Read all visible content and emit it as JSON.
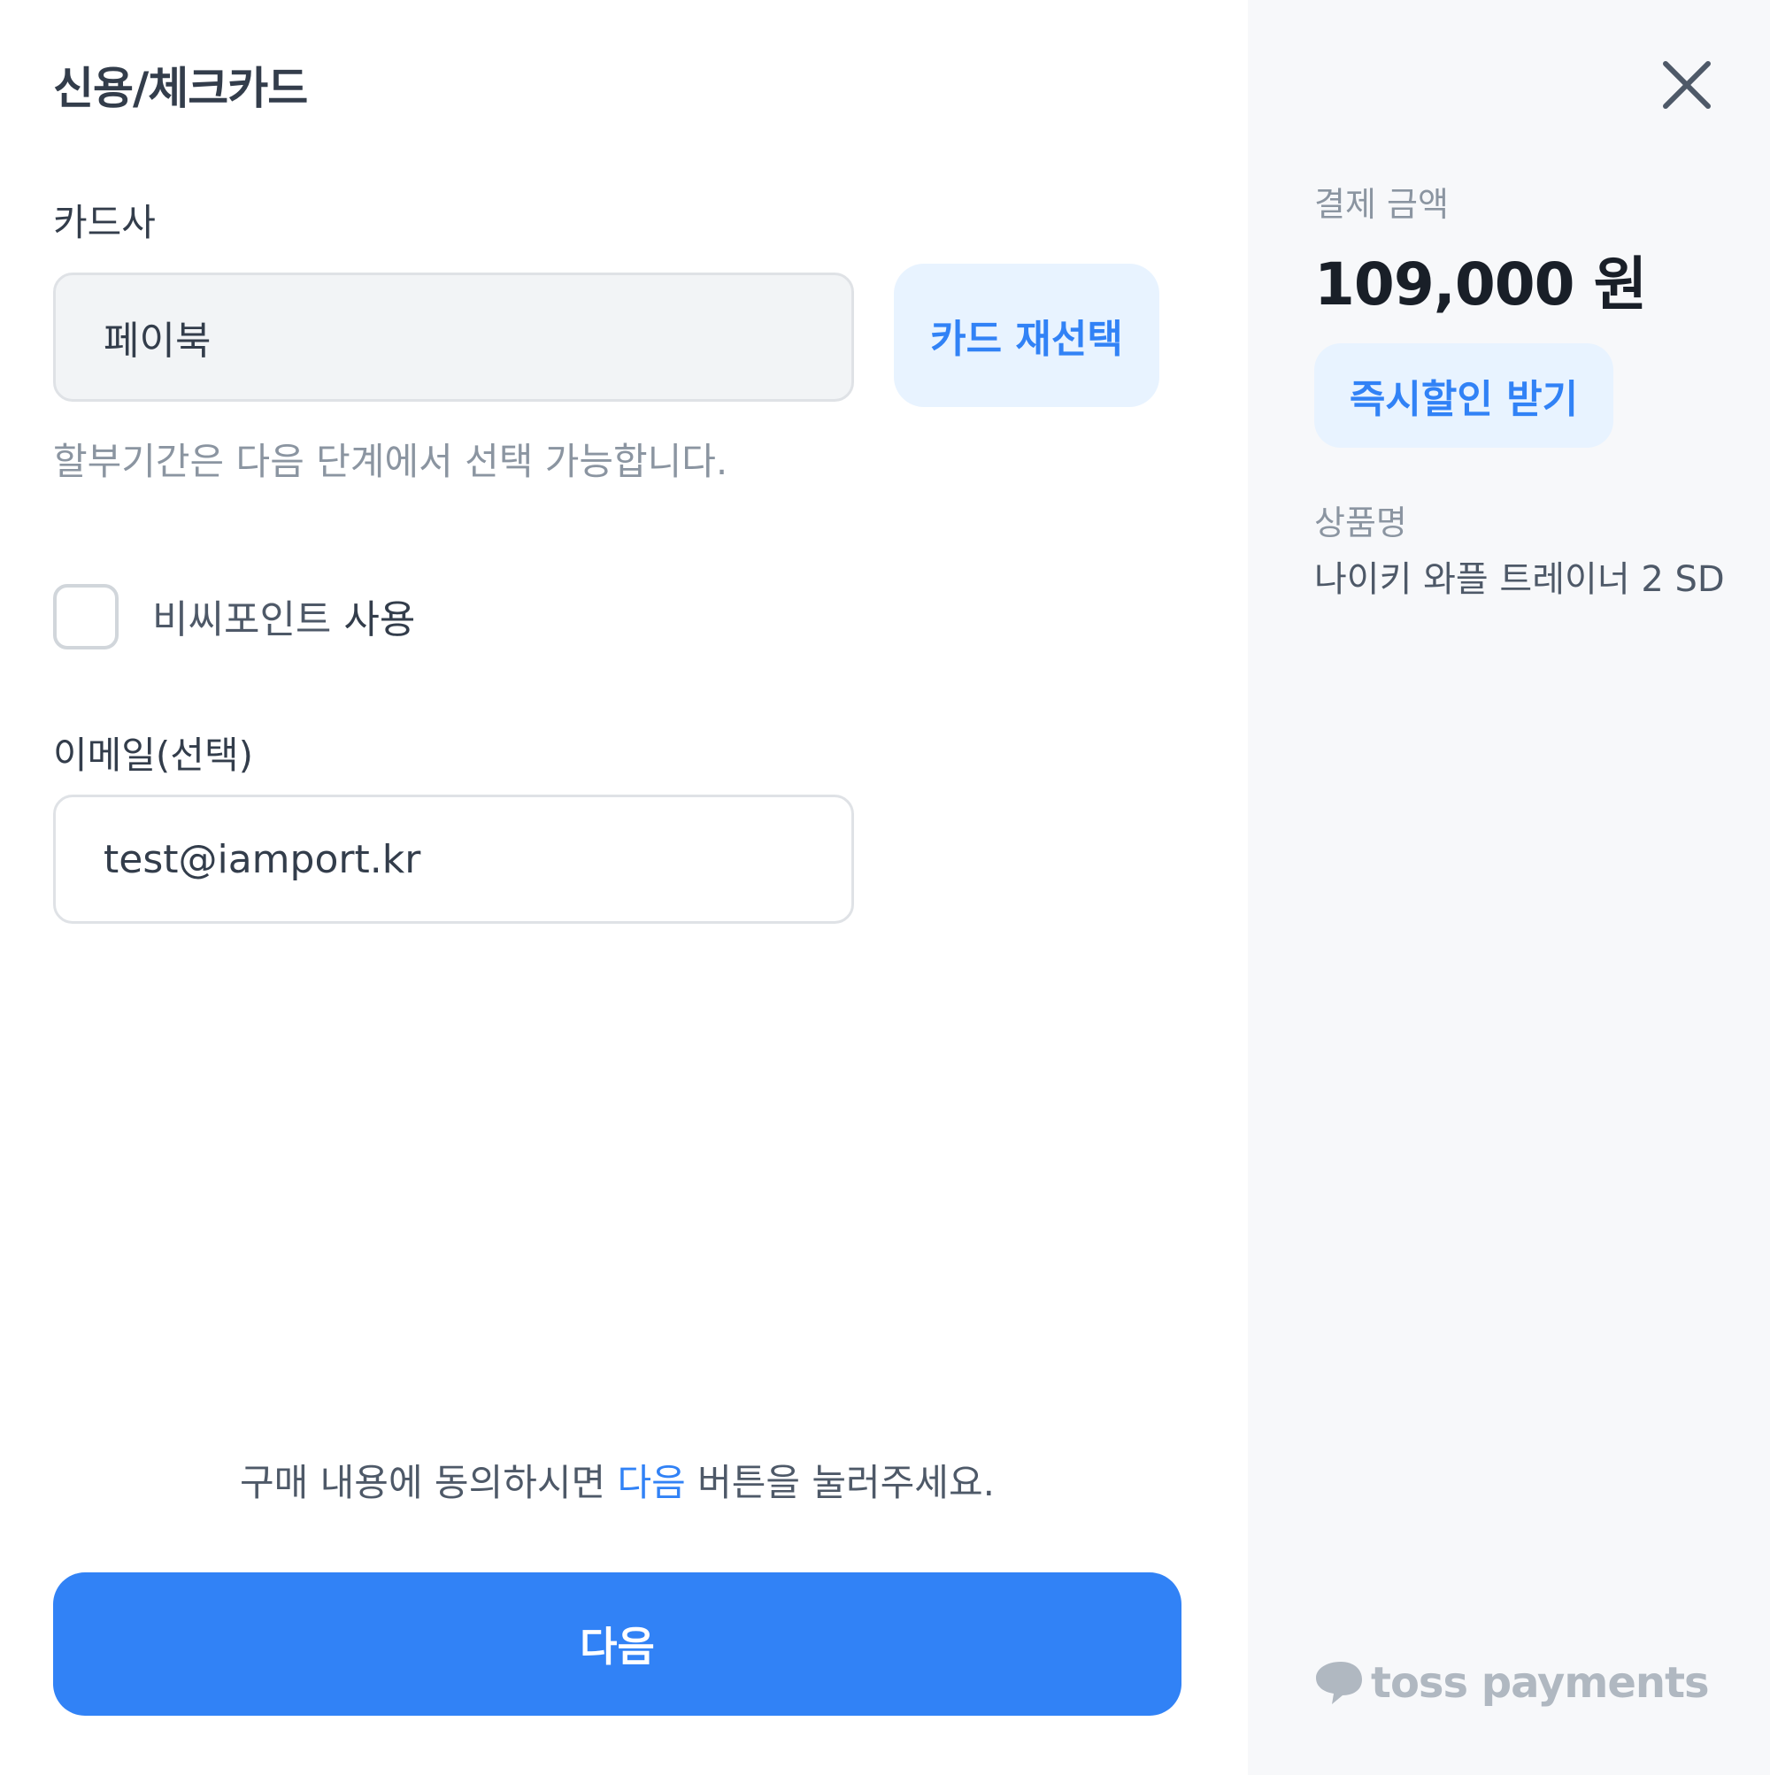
{
  "modal": {
    "title": "신용/체크카드",
    "close_icon": "close-icon"
  },
  "card": {
    "label": "카드사",
    "selected_value": "페이북",
    "reselect_label": "카드 재선택",
    "help_text": "할부기간은 다음 단계에서 선택 가능합니다."
  },
  "point": {
    "label_prefix": "비씨포인트",
    "label_suffix": " 사용",
    "checked": false
  },
  "email": {
    "label": "이메일(선택)",
    "value": "test@iamport.kr"
  },
  "agreement": {
    "before": "구매 내용에 동의하시면 ",
    "link": "다음",
    "after": " 버튼을 눌러주세요."
  },
  "next_label": "다음",
  "summary": {
    "amount_label": "결제 금액",
    "amount": "109,000 원",
    "instant_discount_label": "즉시할인 받기",
    "product_label": "상품명",
    "product_name": "나이키 와플 트레이너 2 SD"
  },
  "brand": {
    "logo_text": "toss payments",
    "logo_icon": "toss-logo-icon"
  },
  "colors": {
    "primary": "#3182f6",
    "primary_light": "#e8f3ff",
    "sidebar_bg": "#f7f8fa"
  }
}
